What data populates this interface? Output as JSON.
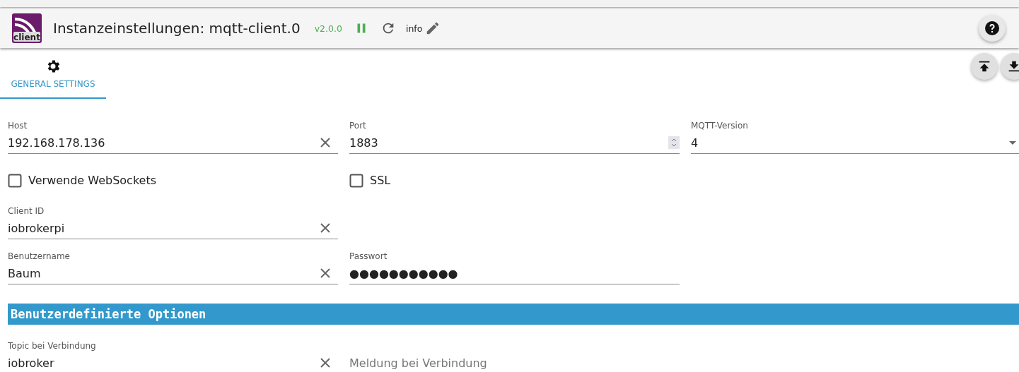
{
  "header": {
    "logo_text": "client",
    "title": "Instanzeinstellungen: mqtt-client.0",
    "version": "v2.0.0",
    "running": true,
    "info": "info"
  },
  "tabs": [
    {
      "label": "GENERAL SETTINGS",
      "selected": true
    }
  ],
  "rows": [
    {
      "items": [
        {
          "kind": "text",
          "label": "Host",
          "value": "192.168.178.136",
          "clearable": true
        },
        {
          "kind": "number",
          "label": "Port",
          "value": "1883"
        },
        {
          "kind": "select",
          "label": "MQTT-Version",
          "value": "4"
        }
      ]
    },
    {
      "items": [
        {
          "kind": "checkbox",
          "label": "Verwende WebSockets",
          "checked": false
        },
        {
          "kind": "checkbox",
          "label": "SSL",
          "checked": false
        }
      ]
    },
    {
      "items": [
        {
          "kind": "text",
          "label": "Client ID",
          "value": "iobrokerpi",
          "clearable": true
        }
      ]
    },
    {
      "items": [
        {
          "kind": "text",
          "label": "Benutzername",
          "value": "Baum",
          "clearable": true
        },
        {
          "kind": "text",
          "label": "Passwort",
          "value": "●●●●●●●●●●●",
          "clearable": false
        }
      ]
    },
    {
      "heading": "Benutzerdefinierte Optionen"
    },
    {
      "items": [
        {
          "kind": "text",
          "label": "Topic bei Verbindung",
          "value": "iobroker",
          "clearable": true
        },
        {
          "kind": "text",
          "placeholder": "Meldung bei Verbindung",
          "clearable": false
        }
      ]
    }
  ]
}
